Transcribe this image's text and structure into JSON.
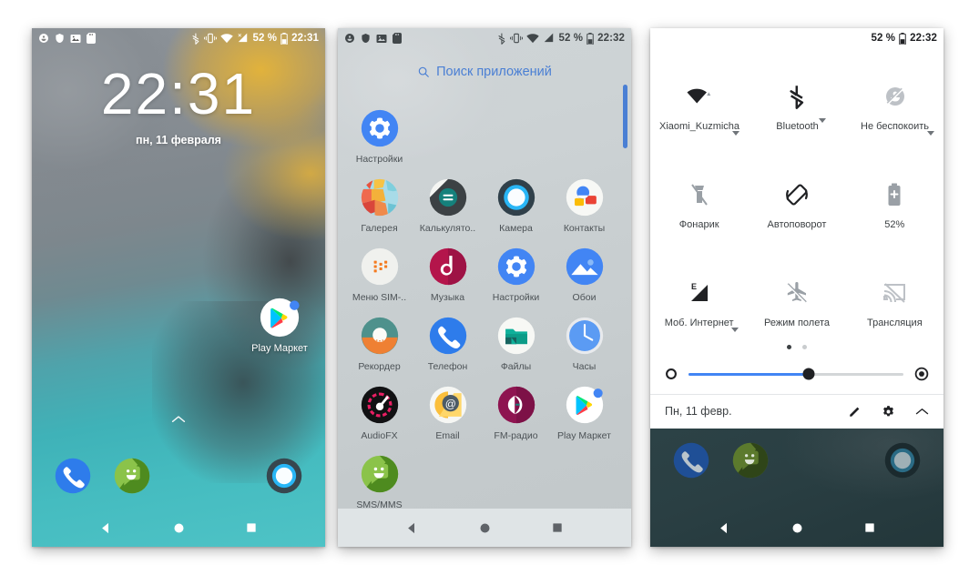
{
  "meta": {
    "accent_blue": "#4285f4",
    "drawer_search_color": "#4a7fd4",
    "qs_text_color": "#3c4043"
  },
  "phone1": {
    "name": "lock-home-screen",
    "statusbar": {
      "left_icons": [
        "do-not-disturb-icon",
        "shield-icon",
        "screenshot-icon",
        "sd-card-icon"
      ],
      "right_icons": [
        "bluetooth-icon",
        "vibrate-icon",
        "wifi-icon",
        "mobile-signal-icon",
        "battery-icon"
      ],
      "battery_percent": "52 %",
      "clock": "22:31"
    },
    "clock": "22:31",
    "date": "пн, 11 февраля",
    "home_icons": [
      {
        "name": "play-market",
        "label": "Play Маркет",
        "icon": "play-store-icon"
      }
    ],
    "swipe_hint": "chevron-up-icon",
    "dock": [
      {
        "name": "phone",
        "icon": "phone-icon"
      },
      {
        "name": "sms-mms",
        "icon": "messaging-icon"
      },
      {
        "name": "camera",
        "icon": "camera-icon"
      }
    ],
    "navbar": [
      "back-icon",
      "home-icon",
      "recents-icon"
    ]
  },
  "phone2": {
    "name": "app-drawer",
    "statusbar": {
      "left_icons": [
        "do-not-disturb-icon",
        "shield-icon",
        "screenshot-icon",
        "sd-card-icon"
      ],
      "right_icons": [
        "bluetooth-icon",
        "vibrate-icon",
        "wifi-icon",
        "mobile-signal-icon",
        "battery-icon"
      ],
      "battery_percent": "52 %",
      "clock": "22:32"
    },
    "search": {
      "label": "Поиск приложений",
      "icon": "search-icon"
    },
    "apps": [
      [
        {
          "label": "Настройки",
          "icon": "settings-icon"
        },
        {
          "label": "",
          "icon": ""
        },
        {
          "label": "",
          "icon": ""
        },
        {
          "label": "",
          "icon": ""
        }
      ],
      [
        {
          "label": "Галерея",
          "icon": "gallery-icon"
        },
        {
          "label": "Калькулято..",
          "icon": "calculator-icon"
        },
        {
          "label": "Камера",
          "icon": "camera-icon"
        },
        {
          "label": "Контакты",
          "icon": "contacts-icon"
        }
      ],
      [
        {
          "label": "Меню SIM-..",
          "icon": "sim-menu-icon"
        },
        {
          "label": "Музыка",
          "icon": "music-icon"
        },
        {
          "label": "Настройки",
          "icon": "settings-icon"
        },
        {
          "label": "Обои",
          "icon": "wallpaper-icon"
        }
      ],
      [
        {
          "label": "Рекордер",
          "icon": "recorder-icon"
        },
        {
          "label": "Телефон",
          "icon": "phone-icon"
        },
        {
          "label": "Файлы",
          "icon": "files-icon"
        },
        {
          "label": "Часы",
          "icon": "clock-icon"
        }
      ],
      [
        {
          "label": "AudioFX",
          "icon": "audiofx-icon"
        },
        {
          "label": "Email",
          "icon": "email-icon"
        },
        {
          "label": "FM-радио",
          "icon": "fm-radio-icon"
        },
        {
          "label": "Play Маркет",
          "icon": "play-store-icon"
        }
      ],
      [
        {
          "label": "SMS/MMS",
          "icon": "messaging-icon"
        },
        {
          "label": "",
          "icon": ""
        },
        {
          "label": "",
          "icon": ""
        },
        {
          "label": "",
          "icon": ""
        }
      ]
    ],
    "navbar": [
      "back-icon",
      "home-icon",
      "recents-icon"
    ]
  },
  "phone3": {
    "name": "quick-settings-panel",
    "statusbar": {
      "battery_percent": "52 %",
      "clock": "22:32"
    },
    "tiles": [
      [
        {
          "label": "Xiaomi_Kuzmicha",
          "icon": "wifi-icon",
          "caret": true,
          "active": true
        },
        {
          "label": "Bluetooth",
          "icon": "bluetooth-icon",
          "caret": true,
          "active": true
        },
        {
          "label": "Не беспокоить",
          "icon": "do-not-disturb-icon",
          "caret": true,
          "active": false
        }
      ],
      [
        {
          "label": "Фонарик",
          "icon": "flashlight-off-icon",
          "caret": false,
          "active": false
        },
        {
          "label": "Автоповорот",
          "icon": "auto-rotate-icon",
          "caret": false,
          "active": true
        },
        {
          "label": "52%",
          "icon": "battery-saver-icon",
          "caret": false,
          "active": false
        }
      ],
      [
        {
          "label": "Моб. Интернет",
          "icon": "mobile-data-icon",
          "caret": true,
          "active": true
        },
        {
          "label": "Режим полета",
          "icon": "airplane-off-icon",
          "caret": false,
          "active": false
        },
        {
          "label": "Трансляция",
          "icon": "cast-icon",
          "caret": false,
          "active": false
        }
      ]
    ],
    "pager": {
      "pages": 2,
      "current": 1
    },
    "brightness": {
      "value_percent": 56,
      "left_icon": "brightness-low-icon",
      "right_icon": "brightness-auto-icon"
    },
    "footer": {
      "date": "Пн, 11 февр.",
      "actions": [
        "edit-icon",
        "gear-icon",
        "collapse-icon"
      ]
    },
    "dock": [
      {
        "name": "phone",
        "icon": "phone-icon"
      },
      {
        "name": "sms-mms",
        "icon": "messaging-icon"
      },
      {
        "name": "camera",
        "icon": "camera-icon"
      }
    ],
    "navbar": [
      "back-icon",
      "home-icon",
      "recents-icon"
    ]
  }
}
